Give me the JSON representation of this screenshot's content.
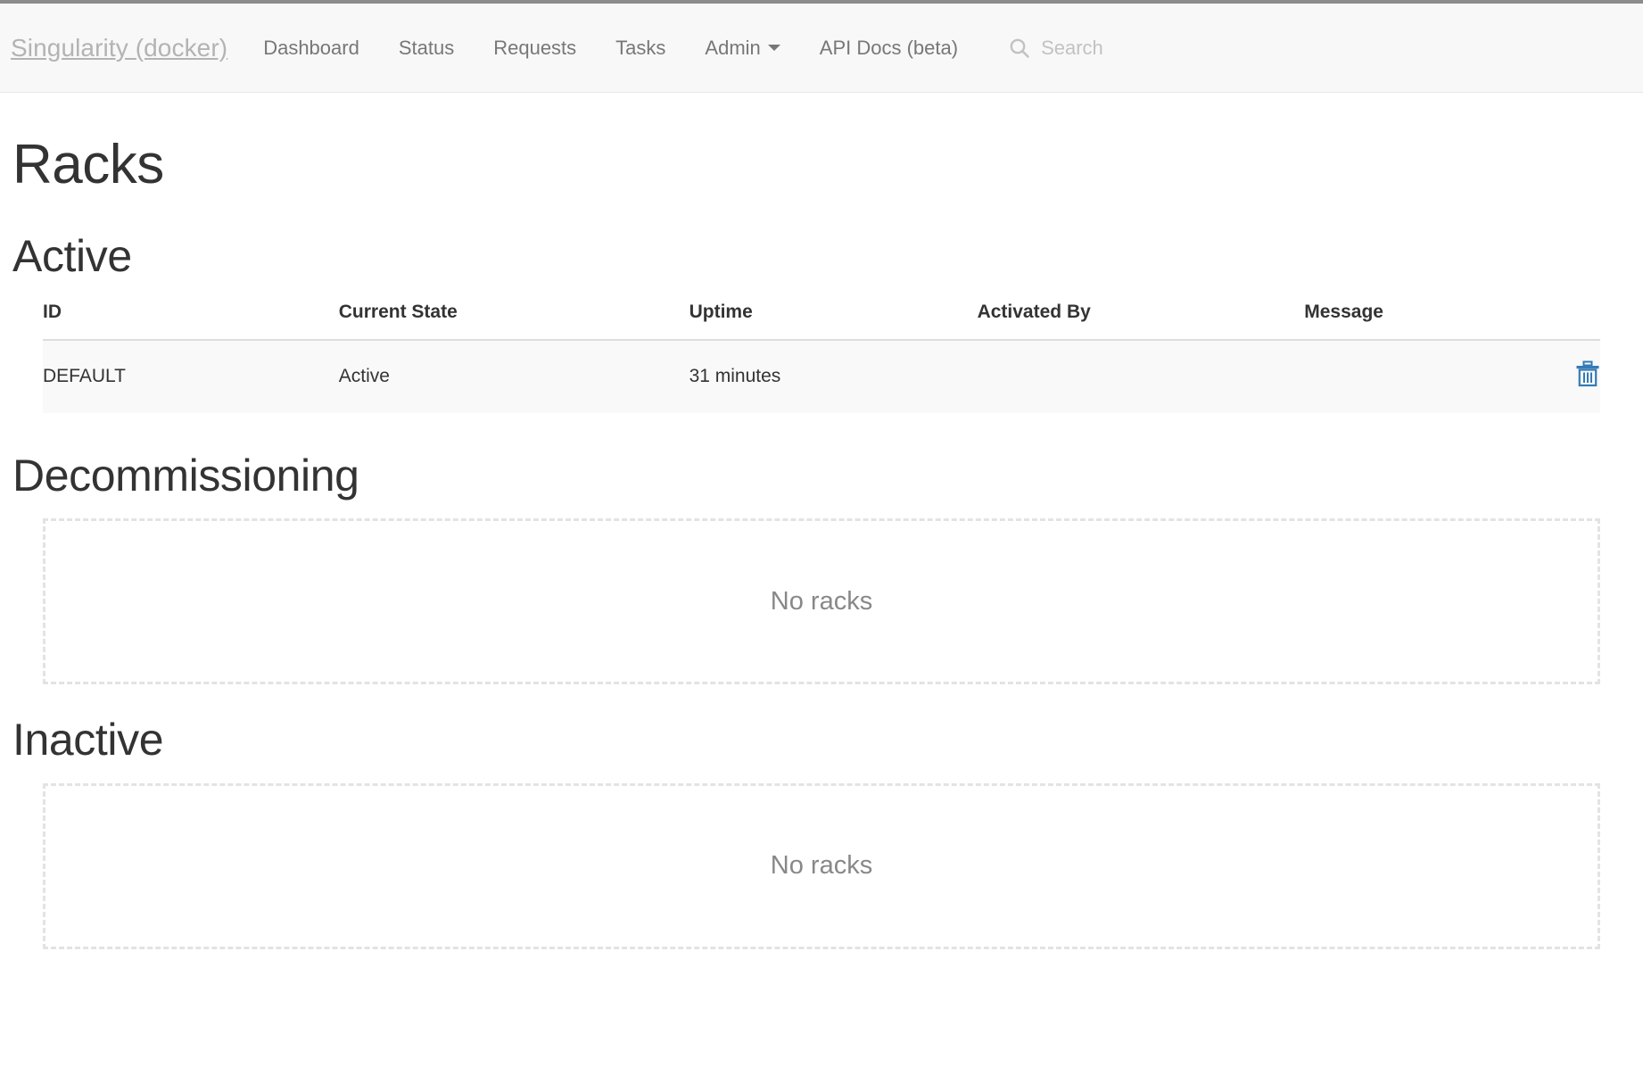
{
  "navbar": {
    "brand": "Singularity (docker)",
    "items": [
      {
        "label": "Dashboard",
        "has_caret": false
      },
      {
        "label": "Status",
        "has_caret": false
      },
      {
        "label": "Requests",
        "has_caret": false
      },
      {
        "label": "Tasks",
        "has_caret": false
      },
      {
        "label": "Admin",
        "has_caret": true
      },
      {
        "label": "API Docs (beta)",
        "has_caret": false
      }
    ],
    "search": {
      "icon": "search-icon",
      "placeholder": "Search",
      "value": ""
    }
  },
  "page": {
    "title": "Racks"
  },
  "sections": {
    "active": {
      "title": "Active",
      "table": {
        "columns": [
          "ID",
          "Current State",
          "Uptime",
          "Activated By",
          "Message",
          ""
        ],
        "rows": [
          {
            "id": "DEFAULT",
            "current_state": "Active",
            "uptime": "31 minutes",
            "activated_by": "",
            "message": "",
            "action_icon": "trash-icon"
          }
        ]
      }
    },
    "decommissioning": {
      "title": "Decommissioning",
      "empty_text": "No racks"
    },
    "inactive": {
      "title": "Inactive",
      "empty_text": "No racks"
    }
  },
  "colors": {
    "navbar_bg": "#f8f8f8",
    "navbar_top_border": "#8c8c8c",
    "brand_text": "#b3b3b3",
    "nav_text": "#777777",
    "heading_text": "#333333",
    "row_bg": "#f9f9f9",
    "dashed_border": "#e3e3e3",
    "empty_text": "#888888",
    "trash_icon": "#337ab7"
  }
}
